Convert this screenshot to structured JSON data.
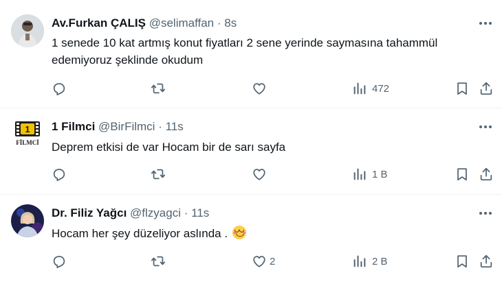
{
  "tweets": [
    {
      "name": "Av.Furkan ÇALIŞ",
      "handle": "@selimaffan",
      "dot": "·",
      "time": "8s",
      "text": "1 senede 10 kat artmış konut fiyatları 2 sene yerinde saymasına tahammül edemiyoruz şeklinde okudum",
      "reply_count": "",
      "retweet_count": "",
      "like_count": "",
      "views": "472"
    },
    {
      "name": "1 Filmci",
      "handle": "@BirFilmci",
      "dot": "·",
      "time": "11s",
      "text": "Deprem etkisi de var Hocam bir de sarı sayfa",
      "reply_count": "",
      "retweet_count": "",
      "like_count": "",
      "views": "1 B",
      "avatar_caption": "FİLMCİ",
      "avatar_number": "1"
    },
    {
      "name": "Dr. Filiz Yağcı",
      "handle": "@flzyagci",
      "dot": "·",
      "time": "11s",
      "text": "Hocam her şey düzeliyor aslında .",
      "emoji": "smiling-face-emoji",
      "reply_count": "",
      "retweet_count": "",
      "like_count": "2",
      "views": "2 B"
    }
  ],
  "icons": {
    "more": "more-icon",
    "reply": "reply-icon",
    "retweet": "retweet-icon",
    "like": "heart-icon",
    "views": "views-icon",
    "bookmark": "bookmark-icon",
    "share": "share-icon"
  },
  "colors": {
    "text": "#0f1419",
    "secondary": "#536471",
    "divider": "#eff3f4"
  }
}
